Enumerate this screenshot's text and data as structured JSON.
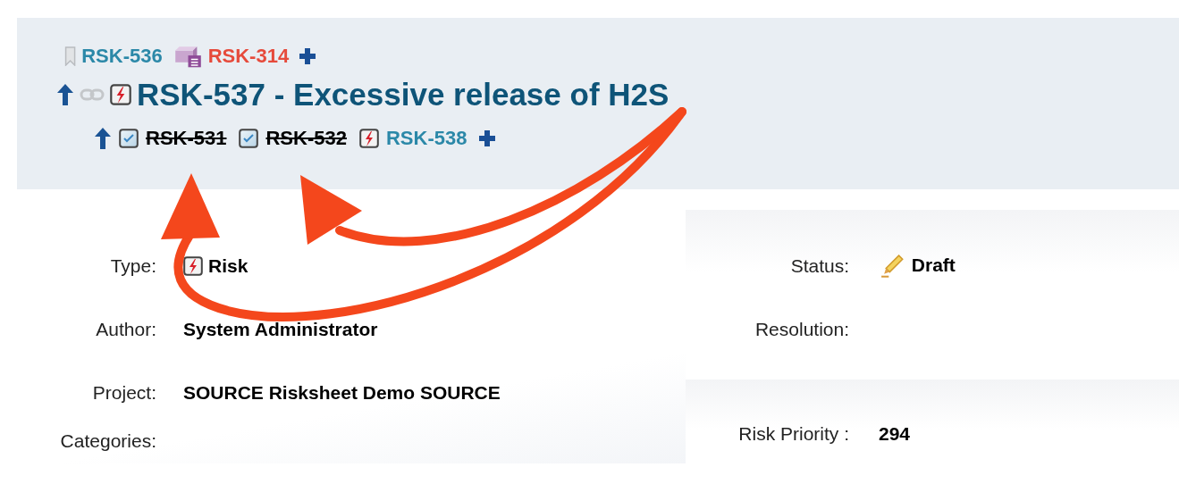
{
  "parent_links": [
    {
      "kind": "bookmark",
      "label": "RSK-536",
      "color": "#2b88a8",
      "resolved": false
    },
    {
      "kind": "package",
      "label": "RSK-314",
      "color": "#e64a3b",
      "resolved": false
    }
  ],
  "title": {
    "kind": "risk",
    "text": "RSK-537 - Excessive release of H2S"
  },
  "child_links": [
    {
      "kind": "task",
      "label": "RSK-531",
      "color": "#000000",
      "resolved": true
    },
    {
      "kind": "task",
      "label": "RSK-532",
      "color": "#000000",
      "resolved": true
    },
    {
      "kind": "risk",
      "label": "RSK-538",
      "color": "#2b88a8",
      "resolved": false
    }
  ],
  "fields_left": [
    {
      "label": "Type:",
      "value": "Risk",
      "kind": "risk"
    },
    {
      "label": "Author:",
      "value": "System Administrator"
    },
    {
      "label": "Project:",
      "value": "SOURCE Risksheet Demo SOURCE"
    },
    {
      "label": "Categories:"
    }
  ],
  "fields_right": [
    {
      "label": "Status:",
      "value": "Draft",
      "kind": "draft"
    },
    {
      "label": "Resolution:"
    },
    {
      "label": "Risk Priority :",
      "value": "294"
    }
  ]
}
